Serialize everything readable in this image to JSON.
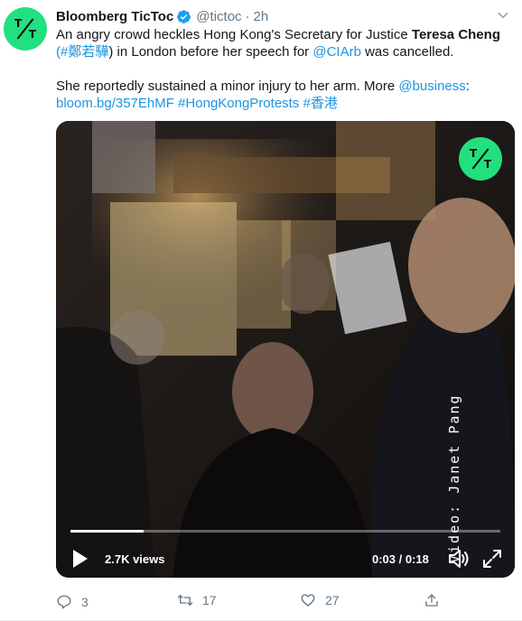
{
  "author": {
    "name": "Bloomberg TicToc",
    "handle": "@tictoc",
    "separator": "·",
    "time": "2h",
    "avatar_icon": "tictoc-logo-icon",
    "avatar_color": "#22e07f"
  },
  "tweet": {
    "p1_a": "An angry crowd heckles Hong Kong's Secretary for Justice ",
    "p1_bold": "Teresa Cheng",
    "p1_hashtag": "(#鄭若驊",
    "p1_paren": ")",
    "p1_b": " in London before her speech for ",
    "p1_mention": "@CIArb",
    "p1_c": " was cancelled.",
    "p2_a": "She reportedly sustained a minor injury to her arm. More ",
    "p2_mention": "@business",
    "p2_colon": ":",
    "p2_link": "bloom.bg/357EhMF",
    "p2_tag1": "#HongKongProtests",
    "p2_tag2": "#香港"
  },
  "video": {
    "watermark_icon": "tictoc-logo-icon",
    "credit": "Video: Janet Pang",
    "views": "2.7K views",
    "time": "0:03 / 0:18",
    "progress": 0.17,
    "play_icon": "play-icon",
    "volume_icon": "volume-icon",
    "expand_icon": "expand-icon"
  },
  "actions": {
    "replies": "3",
    "retweets": "17",
    "likes": "27"
  },
  "colors": {
    "link": "#1b95e0",
    "muted": "#657786",
    "brand": "#22e07f"
  }
}
